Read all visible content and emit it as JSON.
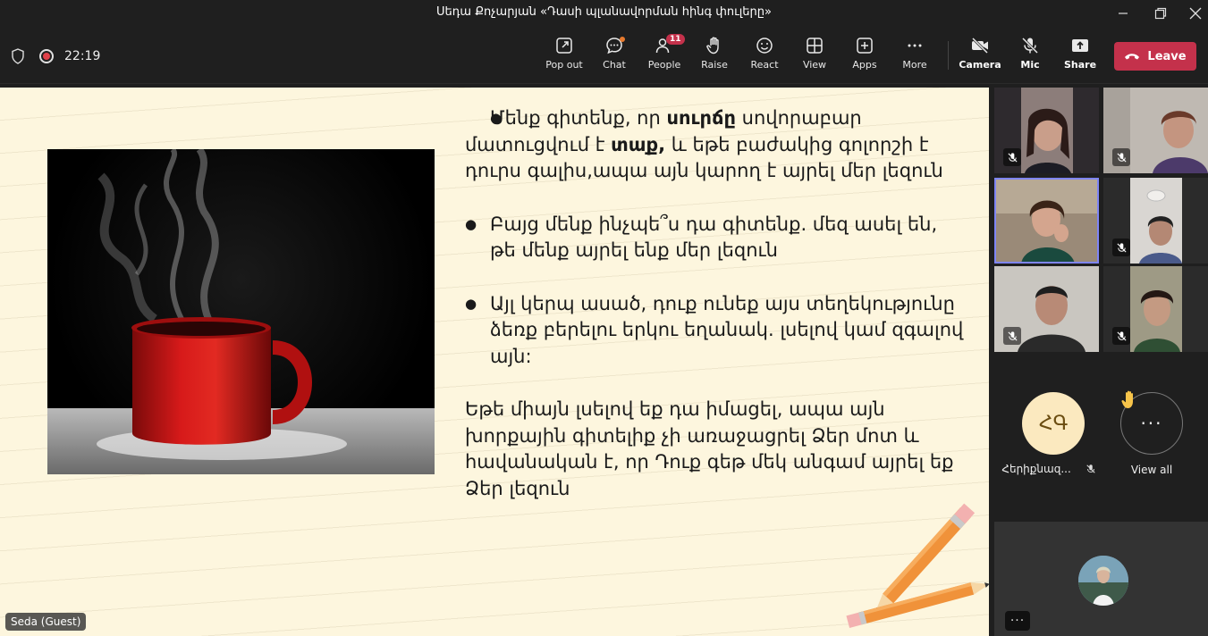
{
  "window": {
    "title": "Սեդա Քոչարյան «Դասի պլանավորման հինգ փուլերը»"
  },
  "toolbar": {
    "timer": "22:19",
    "popout": "Pop out",
    "chat": "Chat",
    "people": "People",
    "people_badge": "11",
    "raise": "Raise",
    "react": "React",
    "view": "View",
    "apps": "Apps",
    "more": "More",
    "camera": "Camera",
    "mic": "Mic",
    "share": "Share",
    "leave": "Leave"
  },
  "slide": {
    "bullet1_a": "Մենք գիտենք, որ ",
    "bullet1_b": "սուրճը",
    "bullet1_c": " սովորաբար մատուցվում է ",
    "bullet1_d": "տաք,",
    "bullet1_e": " և եթե բաժակից գոլորշի է դուրս գալիս,ապա այն կարող է  այրել մեր լեզուն",
    "bullet2": "Բայց մենք ինչպե՞ս դա գիտենք. մեզ ասել են, թե մենք այրել ենք մեր լեզուն",
    "bullet3": "Այլ կերպ ասած, դուք ունեք այս տեղեկությունը ձեռք բերելու երկու եղանակ. լսելով կամ զգալով այն:",
    "paragraph": "Եթե միայն լսելով եք դա իմացել, ապա այն խորքային գիտելիք չի առաջացրել Ձեր մոտ և հավանական է, որ Դուք գեթ մեկ անգամ այրել եք Ձեր լեզուն"
  },
  "presenter_tag": "Seda (Guest)",
  "participants": {
    "initials": "ՀԳ",
    "initials_name": "Հերիքնազ...",
    "view_all": "View all",
    "more_dots": "···"
  },
  "colors": {
    "leave": "#c4314b",
    "badge": "#c4314b",
    "active_tile": "#7f85f5",
    "slide_bg": "#fdf6de"
  }
}
